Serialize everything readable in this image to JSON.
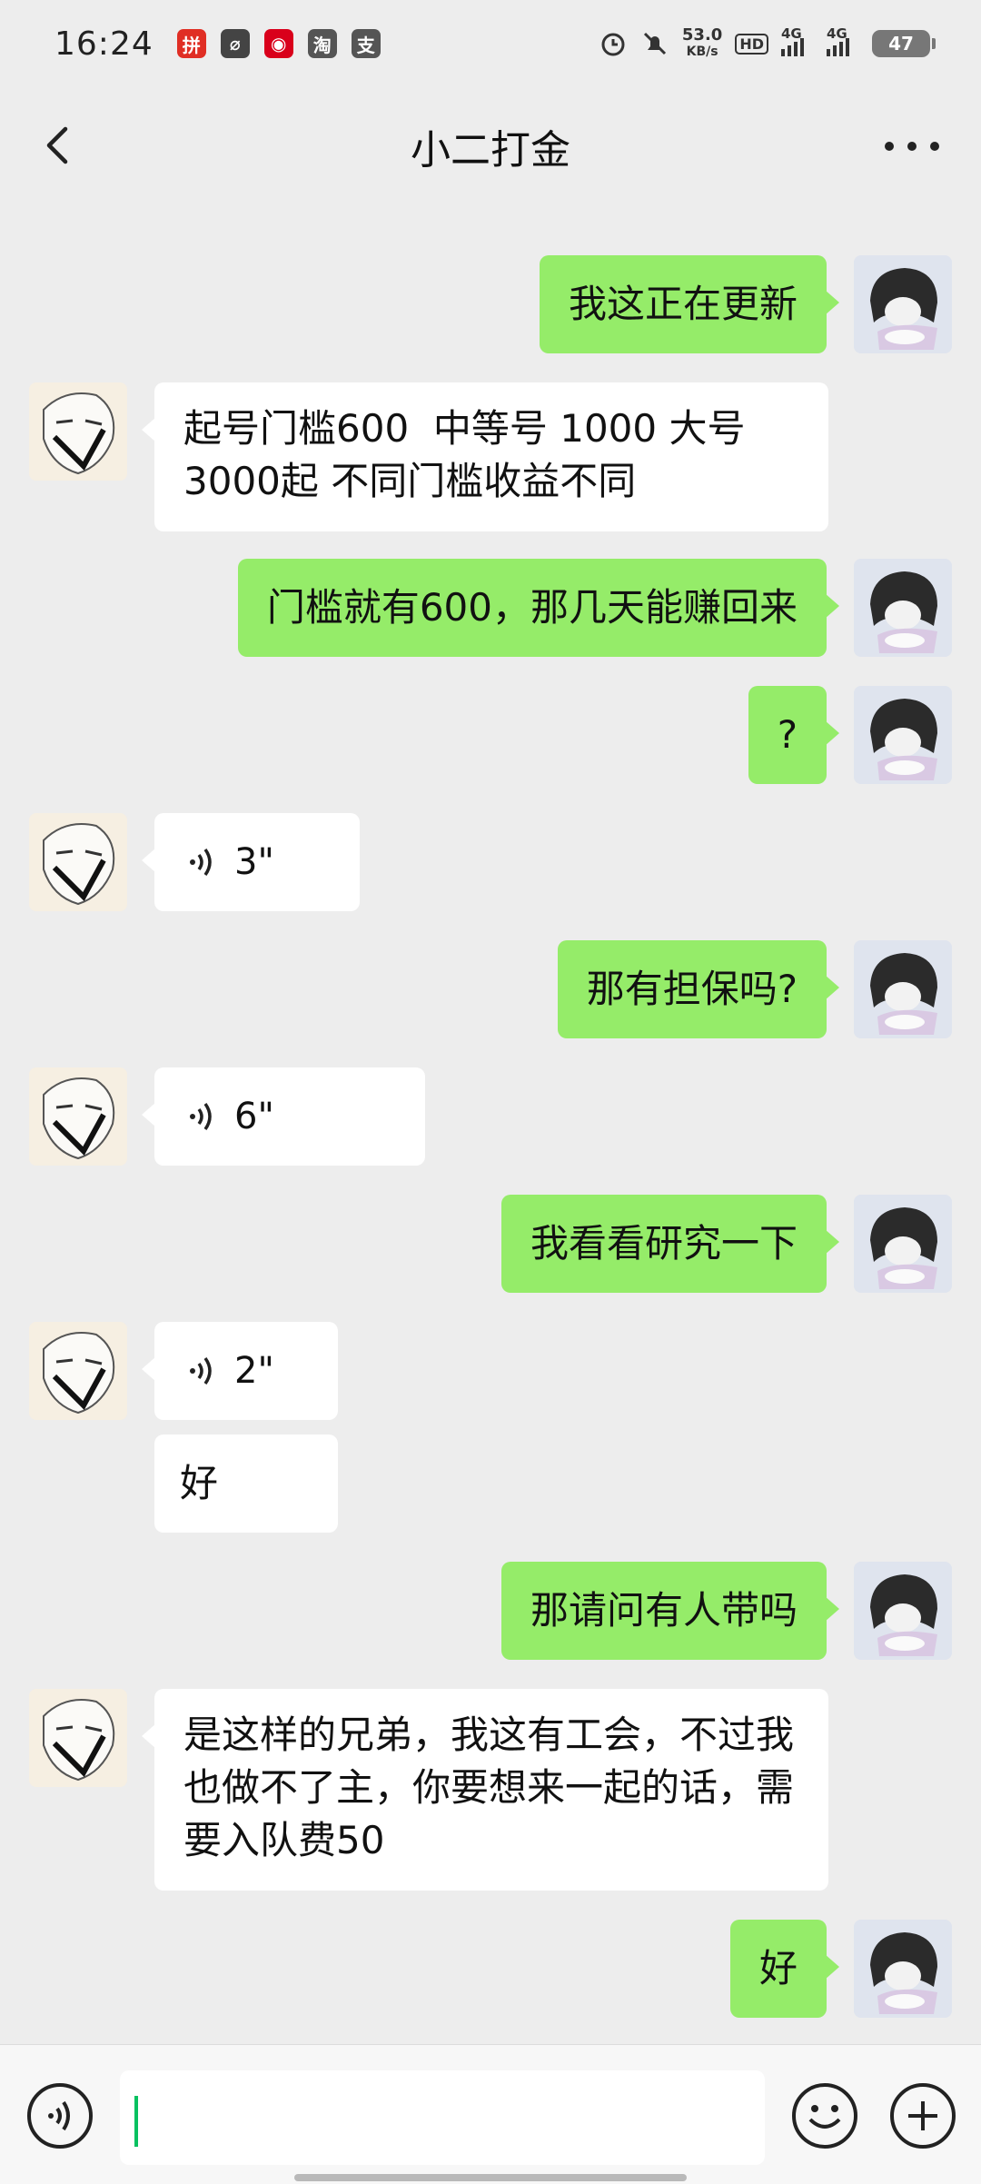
{
  "status_bar": {
    "time": "16:24",
    "net_speed_value": "53.0",
    "net_speed_unit": "KB/s",
    "hd_label": "HD",
    "signal1_label": "4G",
    "signal2_label": "4G",
    "battery": "47",
    "app_icons": [
      {
        "name": "pinduoduo-icon",
        "glyph": "拼",
        "color": "#e02e24"
      },
      {
        "name": "link-icon",
        "glyph": "⌀",
        "color": "#444444"
      },
      {
        "name": "netease-icon",
        "glyph": "◉",
        "color": "#d9001b"
      },
      {
        "name": "taobao-icon",
        "glyph": "淘",
        "color": "#555555"
      },
      {
        "name": "alipay-icon",
        "glyph": "支",
        "color": "#555555"
      }
    ]
  },
  "nav": {
    "title": "小二打金"
  },
  "messages": [
    {
      "from": "me",
      "type": "text",
      "text": "我这正在更新"
    },
    {
      "from": "other",
      "type": "text",
      "text": "起号门槛600  中等号 1000 大号3000起 不同门槛收益不同"
    },
    {
      "from": "me",
      "type": "text",
      "text": "门槛就有600，那几天能赚回来"
    },
    {
      "from": "me",
      "type": "text",
      "text": "?"
    },
    {
      "from": "other",
      "type": "voice",
      "text": "3\""
    },
    {
      "from": "me",
      "type": "text",
      "text": "那有担保吗?"
    },
    {
      "from": "other",
      "type": "voice",
      "text": "6\""
    },
    {
      "from": "me",
      "type": "text",
      "text": "我看看研究一下"
    },
    {
      "from": "other",
      "type": "voice",
      "text": "2\""
    },
    {
      "from": "other",
      "type": "text",
      "text": "好"
    },
    {
      "from": "me",
      "type": "text",
      "text": "那请问有人带吗"
    },
    {
      "from": "other",
      "type": "text",
      "text": "是这样的兄弟，我这有工会，不过我也做不了主，你要想来一起的话，需要入队费50"
    },
    {
      "from": "me",
      "type": "text",
      "text": "好"
    }
  ],
  "input": {
    "value": ""
  },
  "colors": {
    "background": "#ededed",
    "my_bubble": "#95ec69",
    "other_bubble": "#ffffff",
    "cursor": "#07c160"
  }
}
